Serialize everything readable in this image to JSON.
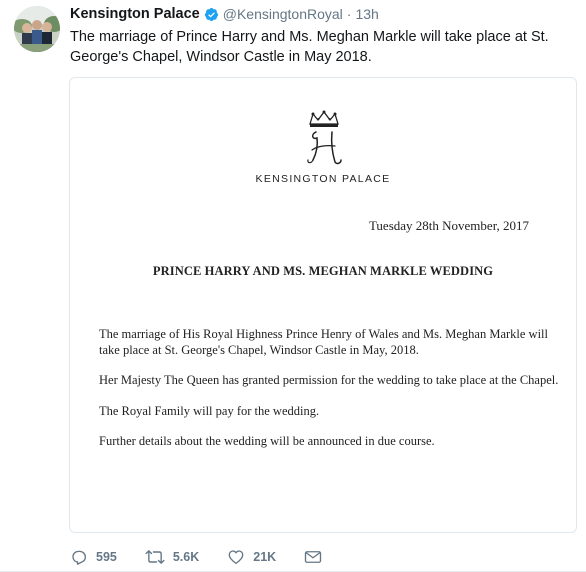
{
  "tweet": {
    "author_name": "Kensington Palace",
    "verified": true,
    "handle": "@KensingtonRoyal",
    "separator": "·",
    "time": "13h",
    "text": "The marriage of Prince Harry and Ms. Meghan Markle will take place at St. George's Chapel, Windsor Castle in May 2018."
  },
  "document": {
    "palace_name": "KENSINGTON PALACE",
    "date": "Tuesday 28th November, 2017",
    "heading": "PRINCE HARRY AND MS. MEGHAN MARKLE WEDDING",
    "paragraphs": [
      "The marriage of His Royal Highness Prince Henry of Wales and Ms. Meghan Markle will take place at St. George's Chapel, Windsor Castle in May, 2018.",
      "Her Majesty The Queen has granted permission for the wedding to take place at the Chapel.",
      "The Royal Family will pay for the wedding.",
      "Further details about the wedding will be announced in due course."
    ]
  },
  "actions": {
    "reply_count": "595",
    "retweet_count": "5.6K",
    "like_count": "21K"
  },
  "icons": [
    "avatar-photo",
    "verified-badge-icon",
    "monogram-h-crown",
    "reply-icon",
    "retweet-icon",
    "like-icon",
    "direct-message-icon"
  ],
  "colors": {
    "verified_blue": "#1da1f2",
    "muted_text": "#657786",
    "primary_text": "#14171a",
    "card_border": "#e1e8ed"
  }
}
